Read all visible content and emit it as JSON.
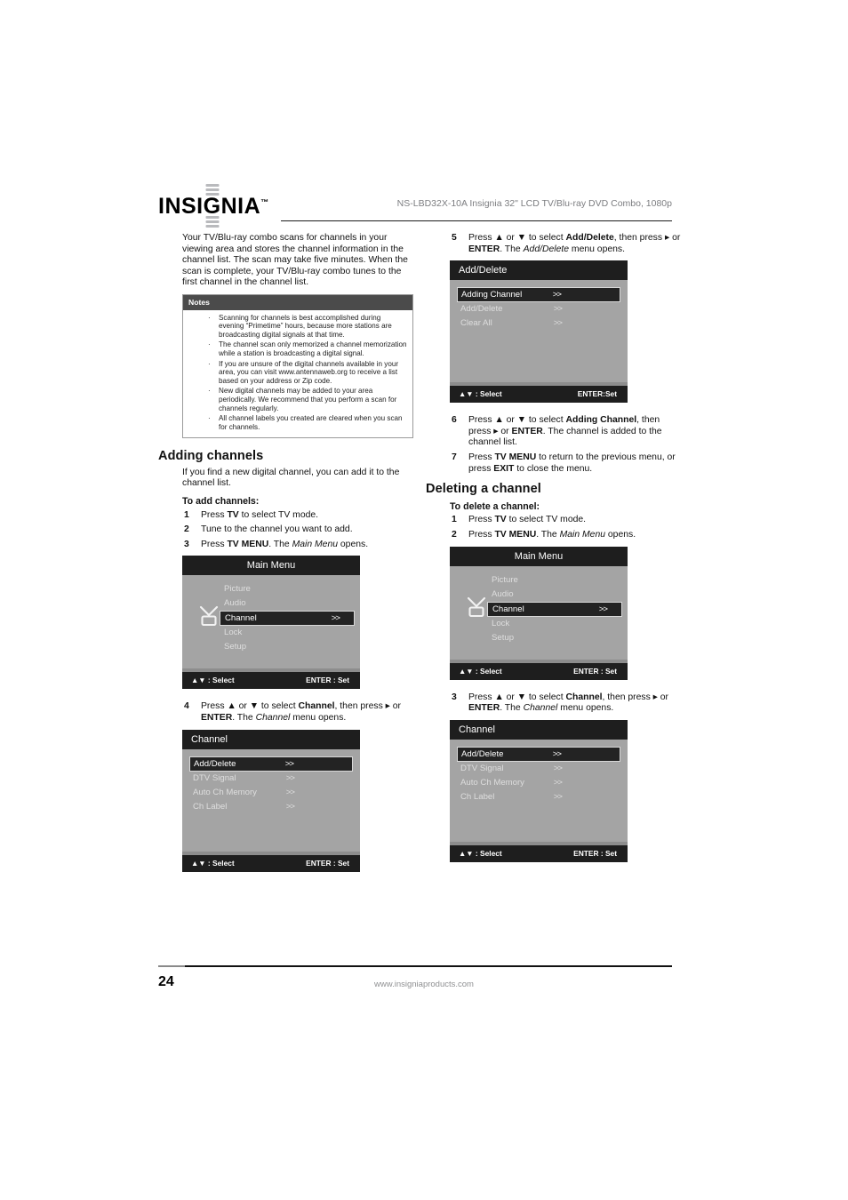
{
  "header": {
    "logo": "INSIGNIA",
    "logo_tm": "™",
    "model_title": "NS-LBD32X-10A Insignia 32\" LCD TV/Blu-ray DVD Combo, 1080p"
  },
  "footer": {
    "page_number": "24",
    "website": "www.insigniaproducts.com"
  },
  "left": {
    "intro": "Your TV/Blu-ray combo scans for channels in your viewing area and stores the channel information in the channel list. The scan may take five minutes. When the scan is complete, your TV/Blu-ray combo tunes to the first channel in the channel list.",
    "notes": {
      "title": "Notes",
      "items": [
        "Scanning for channels is best accomplished during evening “Primetime” hours, because more stations are broadcasting digital signals at that time.",
        "The channel scan only memorized a channel memorization while a station is broadcasting a digital signal.",
        "If you are unsure of the digital channels available in your area, you can visit www.antennaweb.org to receive a list based on your address or Zip code.",
        "New digital channels may be added to your area periodically. We recommend that you perform a scan for channels regularly.",
        "All channel labels you created are cleared when you scan for channels."
      ]
    },
    "heading": "Adding channels",
    "lead": "If you find a new digital channel, you can add it to the channel list.",
    "subheading": "To add channels:",
    "steps": [
      {
        "num": "1",
        "text_html": "Press <b>TV</b> to select TV mode."
      },
      {
        "num": "2",
        "text_html": "Tune to the channel you want to add."
      },
      {
        "num": "3",
        "text_html": "Press <b>TV MENU</b>. The <i>Main Menu</i> opens."
      }
    ],
    "step4": {
      "num": "4",
      "text_html": "Press ▲ or ▼ to select <b>Channel</b>, then press ▸ or <b>ENTER</b>. The <i>Channel</i> menu opens."
    }
  },
  "right": {
    "step5": {
      "num": "5",
      "text_html": "Press ▲ or ▼ to select <b>Add/Delete</b>, then press ▸ or <b>ENTER</b>. The <i>Add/Delete</i> menu opens."
    },
    "step6": {
      "num": "6",
      "text_html": "Press ▲ or ▼ to select <b>Adding Channel</b>, then press ▸ or <b>ENTER</b>. The channel is added to the channel list."
    },
    "step7": {
      "num": "7",
      "text_html": "Press <b>TV MENU</b> to return to the previous menu, or press <b>EXIT</b> to close the menu."
    },
    "heading": "Deleting a channel",
    "subheading": "To delete a channel:",
    "steps": [
      {
        "num": "1",
        "text_html": "Press <b>TV</b> to select TV mode."
      },
      {
        "num": "2",
        "text_html": "Press <b>TV MENU</b>. The <i>Main Menu</i> opens."
      }
    ],
    "step3": {
      "num": "3",
      "text_html": "Press ▲ or ▼ to select <b>Channel</b>, then press ▸ or <b>ENTER</b>. The <i>Channel</i> menu opens."
    }
  },
  "osd": {
    "main_menu_1": {
      "title": "Main Menu",
      "title_align": "center",
      "icon": "tv-antenna-icon",
      "rows": [
        {
          "label": "Picture",
          "chevron": "",
          "selected": false
        },
        {
          "label": "Audio",
          "chevron": "",
          "selected": false
        },
        {
          "label": "Channel",
          "chevron": ">>",
          "selected": true
        },
        {
          "label": "Lock",
          "chevron": "",
          "selected": false
        },
        {
          "label": "Setup",
          "chevron": "",
          "selected": false
        }
      ],
      "foot_left": "▲▼ : Select",
      "foot_right": "ENTER : Set"
    },
    "channel_1": {
      "title": "Channel",
      "title_align": "left",
      "rows": [
        {
          "label": "Add/Delete",
          "chevron": ">>",
          "selected": true
        },
        {
          "label": "DTV Signal",
          "chevron": ">>",
          "selected": false
        },
        {
          "label": "Auto Ch Memory",
          "chevron": ">>",
          "selected": false
        },
        {
          "label": "Ch Label",
          "chevron": ">>",
          "selected": false
        }
      ],
      "foot_left": "▲▼ : Select",
      "foot_right": "ENTER : Set"
    },
    "add_delete": {
      "title": "Add/Delete",
      "title_align": "left",
      "rows": [
        {
          "label": "Adding Channel",
          "chevron": ">>",
          "selected": true
        },
        {
          "label": "Add/Delete",
          "chevron": ">>",
          "selected": false
        },
        {
          "label": "Clear All",
          "chevron": ">>",
          "selected": false
        }
      ],
      "foot_left": "▲▼ : Select",
      "foot_right": "ENTER:Set"
    },
    "main_menu_2": {
      "title": "Main Menu",
      "title_align": "center",
      "icon": "tv-antenna-icon",
      "rows": [
        {
          "label": "Picture",
          "chevron": "",
          "selected": false
        },
        {
          "label": "Audio",
          "chevron": "",
          "selected": false
        },
        {
          "label": "Channel",
          "chevron": ">>",
          "selected": true
        },
        {
          "label": "Lock",
          "chevron": "",
          "selected": false
        },
        {
          "label": "Setup",
          "chevron": "",
          "selected": false
        }
      ],
      "foot_left": "▲▼ : Select",
      "foot_right": "ENTER : Set"
    },
    "channel_2": {
      "title": "Channel",
      "title_align": "left",
      "rows": [
        {
          "label": "Add/Delete",
          "chevron": ">>",
          "selected": true
        },
        {
          "label": "DTV Signal",
          "chevron": ">>",
          "selected": false
        },
        {
          "label": "Auto Ch Memory",
          "chevron": ">>",
          "selected": false
        },
        {
          "label": "Ch Label",
          "chevron": ">>",
          "selected": false
        }
      ],
      "foot_left": "▲▼ : Select",
      "foot_right": "ENTER : Set"
    }
  },
  "colors": {
    "osd_bg": "#a4a4a4",
    "osd_bar": "#1e1e1e",
    "osd_selected": "#232323",
    "osd_text": "#dedede",
    "notes_header": "#4b4b4b",
    "header_title": "#7c7d80",
    "site_text": "#8f9092"
  }
}
